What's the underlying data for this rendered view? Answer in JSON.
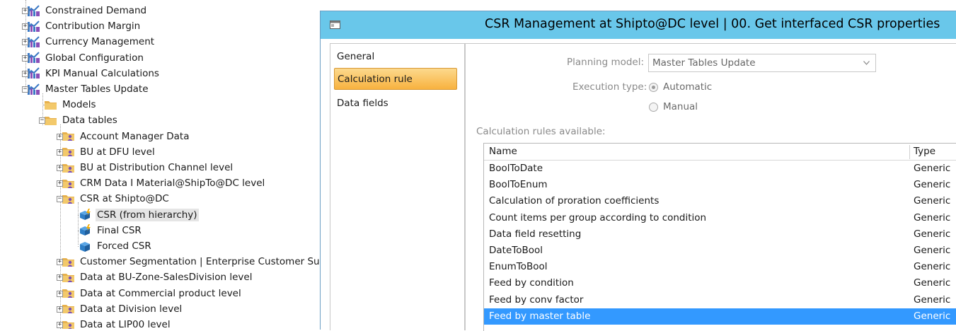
{
  "tree": {
    "items": [
      {
        "label": "Constrained Demand",
        "icon": "model-icon",
        "level": 0,
        "expander": "+"
      },
      {
        "label": "Contribution Margin",
        "icon": "model-icon",
        "level": 0,
        "expander": "+"
      },
      {
        "label": "Currency Management",
        "icon": "model-icon",
        "level": 0,
        "expander": "+"
      },
      {
        "label": "Global Configuration",
        "icon": "model-icon",
        "level": 0,
        "expander": "+"
      },
      {
        "label": "KPI Manual Calculations",
        "icon": "model-icon",
        "level": 0,
        "expander": "+"
      },
      {
        "label": "Master Tables Update",
        "icon": "model-icon",
        "level": 0,
        "expander": "−"
      },
      {
        "label": "Models",
        "icon": "folder-icon",
        "level": 1,
        "expander": ""
      },
      {
        "label": "Data tables",
        "icon": "folder-icon",
        "level": 1,
        "expander": "−"
      },
      {
        "label": "Account Manager Data",
        "icon": "data-table-icon",
        "level": 2,
        "expander": "+"
      },
      {
        "label": "BU at DFU level",
        "icon": "data-table-icon",
        "level": 2,
        "expander": "+"
      },
      {
        "label": "BU at Distribution Channel level",
        "icon": "data-table-icon",
        "level": 2,
        "expander": "+"
      },
      {
        "label": "CRM Data I Material@ShipTo@DC level",
        "icon": "data-table-icon",
        "level": 2,
        "expander": "+"
      },
      {
        "label": "CSR at Shipto@DC",
        "icon": "data-table-icon",
        "level": 2,
        "expander": "−"
      },
      {
        "label": "CSR (from hierarchy)",
        "icon": "cube-bolt-icon",
        "level": 3,
        "expander": "",
        "selected": true
      },
      {
        "label": "Final CSR",
        "icon": "cube-bolt-icon",
        "level": 3,
        "expander": ""
      },
      {
        "label": "Forced CSR",
        "icon": "cube-icon",
        "level": 3,
        "expander": ""
      },
      {
        "label": "Customer Segmentation | Enterprise Customer Sub",
        "icon": "data-table-icon",
        "level": 2,
        "expander": "+"
      },
      {
        "label": "Data at BU-Zone-SalesDivision level",
        "icon": "data-table-icon",
        "level": 2,
        "expander": "+"
      },
      {
        "label": "Data at Commercial product level",
        "icon": "data-table-icon",
        "level": 2,
        "expander": "+"
      },
      {
        "label": "Data at Division level",
        "icon": "data-table-icon",
        "level": 2,
        "expander": "+"
      },
      {
        "label": "Data at LIP00 level",
        "icon": "data-table-icon",
        "level": 2,
        "expander": "+"
      }
    ]
  },
  "dialog": {
    "title": "CSR Management at Shipto@DC level | 00. Get interfaced CSR properties",
    "nav": [
      {
        "label": "General",
        "active": false
      },
      {
        "label": "Calculation rule",
        "active": true
      },
      {
        "label": "Data fields",
        "active": false
      }
    ],
    "planning_model_label": "Planning model:",
    "planning_model_value": "Master Tables Update",
    "execution_type_label": "Execution type:",
    "execution_options": [
      {
        "label": "Automatic",
        "checked": true
      },
      {
        "label": "Manual",
        "checked": false
      }
    ],
    "rules_caption": "Calculation rules available:",
    "grid": {
      "columns": [
        "Name",
        "Type"
      ],
      "rows": [
        {
          "name": "BoolToDate",
          "type": "Generic"
        },
        {
          "name": "BoolToEnum",
          "type": "Generic"
        },
        {
          "name": "Calculation of proration coefficients",
          "type": "Generic"
        },
        {
          "name": "Count items per group according to condition",
          "type": "Generic"
        },
        {
          "name": "Data field resetting",
          "type": "Generic"
        },
        {
          "name": "DateToBool",
          "type": "Generic"
        },
        {
          "name": "EnumToBool",
          "type": "Generic"
        },
        {
          "name": "Feed by condition",
          "type": "Generic"
        },
        {
          "name": "Feed by conv factor",
          "type": "Generic"
        },
        {
          "name": "Feed by master table",
          "type": "Generic",
          "selected": true
        }
      ]
    }
  },
  "colors": {
    "titlebar": "#69c7ea",
    "nav_active": "#f8b23f",
    "selection": "#3399ff",
    "folder": "#e7b14d",
    "cube": "#2f7fc7",
    "model_icon": "#3a78c4"
  }
}
